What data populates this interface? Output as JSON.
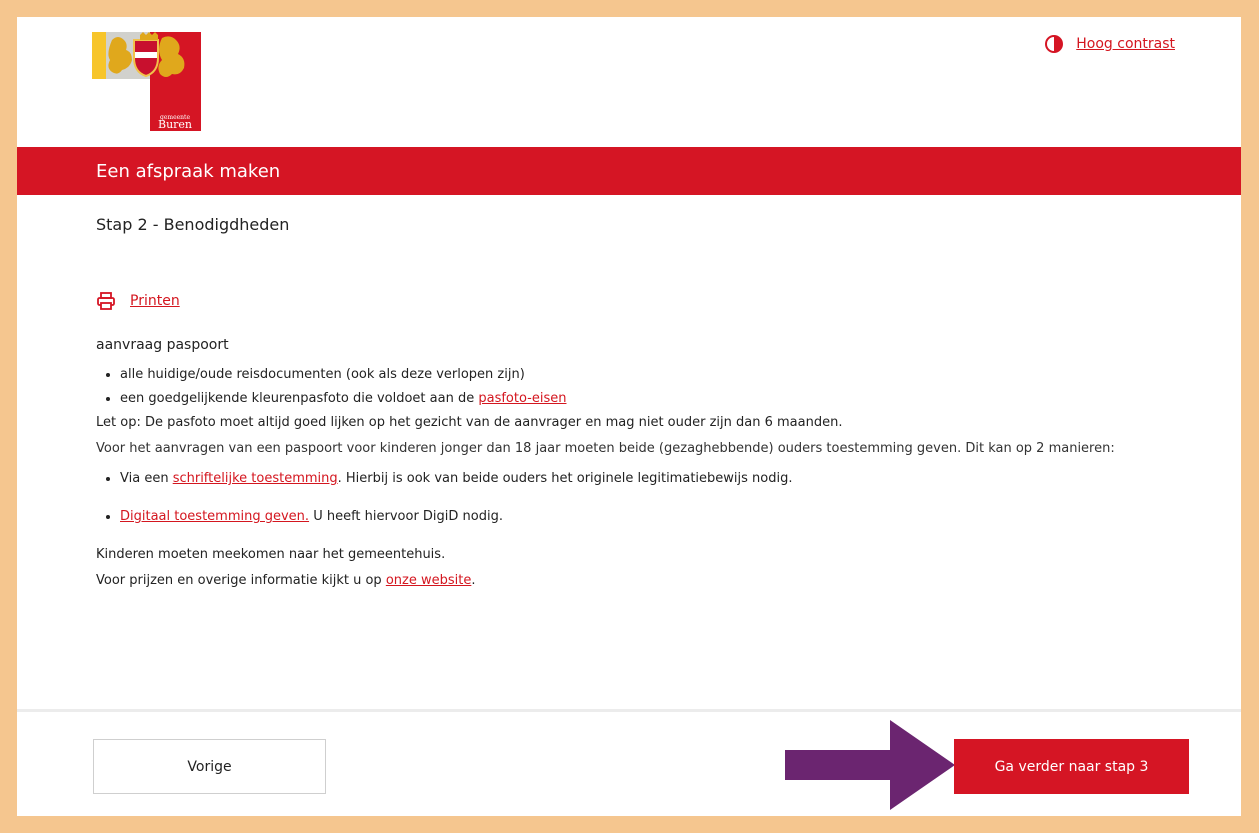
{
  "header": {
    "logo_text": "Buren",
    "logo_small_text": "gemeente",
    "contrast_label": "Hoog contrast"
  },
  "banner": {
    "title": "Een afspraak maken"
  },
  "step": {
    "title": "Stap 2 - Benodigdheden"
  },
  "print": {
    "label": "Printen"
  },
  "content": {
    "service": "aanvraag paspoort",
    "docs": [
      {
        "text": "alle huidige/oude reisdocumenten (ook als deze verlopen zijn)"
      },
      {
        "text": "een goedgelijkende kleurenpasfoto die voldoet aan de ",
        "link": "pasfoto-eisen"
      }
    ],
    "note": "Let op: De pasfoto moet altijd goed lijken op het gezicht van de aanvrager en mag niet ouder zijn dan 6 maanden.",
    "children_info": "Voor het aanvragen van een paspoort voor kinderen jonger dan 18 jaar moeten beide (gezaghebbende) ouders toestemming geven. Dit kan op 2 manieren:",
    "consent": [
      {
        "before": "Via een ",
        "link": "schriftelijke toestemming",
        "after": ". Hierbij is ook van beide ouders het originele legitimatiebewijs nodig."
      },
      {
        "before": "",
        "link": "Digitaal toestemming geven.",
        "after": " U heeft hiervoor DigiD nodig."
      }
    ],
    "kids_come": "Kinderen moeten meekomen naar het gemeentehuis.",
    "prices_before": "Voor prijzen en overige informatie kijkt u op ",
    "prices_link": "onze website",
    "prices_after": "."
  },
  "footer": {
    "prev_label": "Vorige",
    "next_label": "Ga verder naar stap 3"
  },
  "colors": {
    "page_border": "#f5c68f",
    "brand_red": "#d51524",
    "arrow_purple": "#6b2570"
  },
  "icons": {
    "contrast": "contrast-icon",
    "print": "printer-icon",
    "arrow": "arrow-right-icon"
  }
}
